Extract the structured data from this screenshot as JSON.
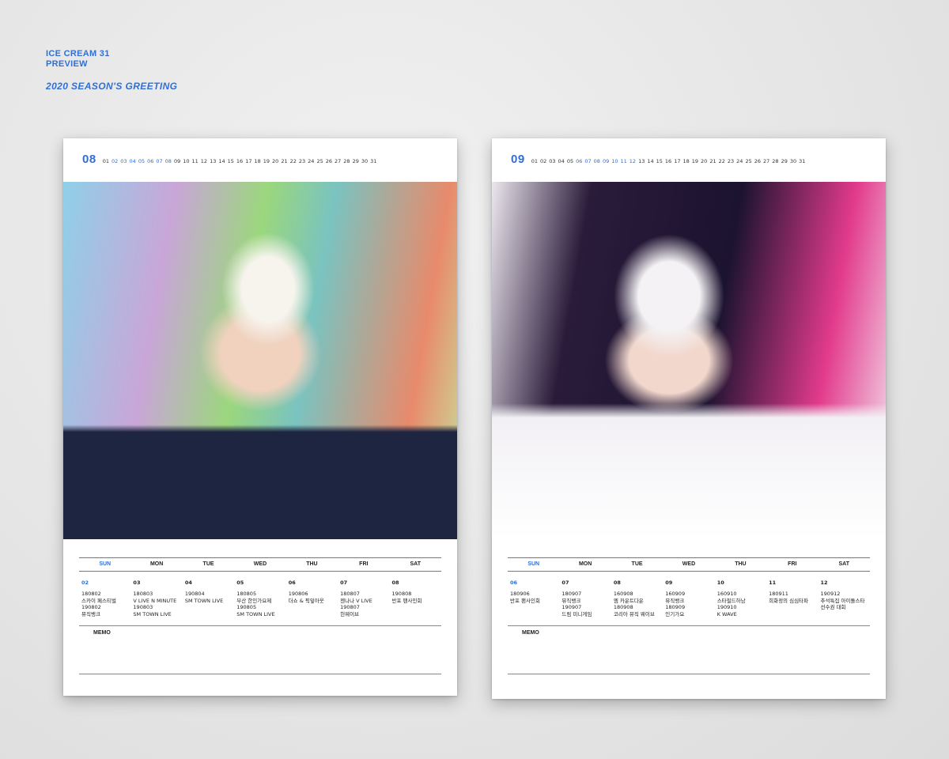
{
  "brand": {
    "line1": "ICE CREAM 31",
    "line2": "PREVIEW",
    "line3": "2020 SEASON'S GREETING"
  },
  "weekdays": [
    "SUN",
    "MON",
    "TUE",
    "WED",
    "THU",
    "FRI",
    "SAT"
  ],
  "memo_label": "MEMO",
  "pages": [
    {
      "month": "08",
      "days": [
        "01",
        "02",
        "03",
        "04",
        "05",
        "06",
        "07",
        "08",
        "09",
        "10",
        "11",
        "12",
        "13",
        "14",
        "15",
        "16",
        "17",
        "18",
        "19",
        "20",
        "21",
        "22",
        "23",
        "24",
        "25",
        "26",
        "27",
        "28",
        "29",
        "30",
        "31"
      ],
      "highlighted_days": [
        "02",
        "03",
        "04",
        "05",
        "06",
        "07",
        "08"
      ],
      "week": [
        {
          "day": "02",
          "events": [
            "180802",
            "스카이 페스티벌",
            "190802",
            "뮤직뱅크"
          ]
        },
        {
          "day": "03",
          "events": [
            "180803",
            "V LIVE N MINUTE",
            "190803",
            "SM TOWN LIVE"
          ]
        },
        {
          "day": "04",
          "events": [
            "190804",
            "SM TOWN LIVE"
          ]
        },
        {
          "day": "05",
          "events": [
            "180805",
            "부산 한인가요제",
            "190805",
            "SM TOWN LIVE"
          ]
        },
        {
          "day": "06",
          "events": [
            "190806",
            "더쇼 & 픽잎아웃"
          ]
        },
        {
          "day": "07",
          "events": [
            "180807",
            "젠나나 V LIVE",
            "190807",
            "헌웨이브"
          ]
        },
        {
          "day": "08",
          "events": [
            "190808",
            "반포 팬사인회"
          ]
        }
      ]
    },
    {
      "month": "09",
      "days": [
        "01",
        "02",
        "03",
        "04",
        "05",
        "06",
        "07",
        "08",
        "09",
        "10",
        "11",
        "12",
        "13",
        "14",
        "15",
        "16",
        "17",
        "18",
        "19",
        "20",
        "21",
        "22",
        "23",
        "24",
        "25",
        "26",
        "27",
        "28",
        "29",
        "30",
        "31"
      ],
      "highlighted_days": [
        "06",
        "07",
        "08",
        "09",
        "10",
        "11",
        "12"
      ],
      "week": [
        {
          "day": "06",
          "events": [
            "180906",
            "반포 팬사인회"
          ]
        },
        {
          "day": "07",
          "events": [
            "180907",
            "뮤직뱅크",
            "190907",
            "드림 미니게임"
          ]
        },
        {
          "day": "08",
          "events": [
            "160908",
            "엠 카운트다운",
            "180908",
            "코리아 뮤직 웨이브"
          ]
        },
        {
          "day": "09",
          "events": [
            "160909",
            "뮤직뱅크",
            "180909",
            "인기가요"
          ]
        },
        {
          "day": "10",
          "events": [
            "160910",
            "스타필드하남",
            "190910",
            "K WAVE"
          ]
        },
        {
          "day": "11",
          "events": [
            "180911",
            "희화정의 심심타파"
          ]
        },
        {
          "day": "12",
          "events": [
            "190912",
            "추석특집 아이돌스타",
            "선수권 대회"
          ]
        }
      ]
    }
  ]
}
